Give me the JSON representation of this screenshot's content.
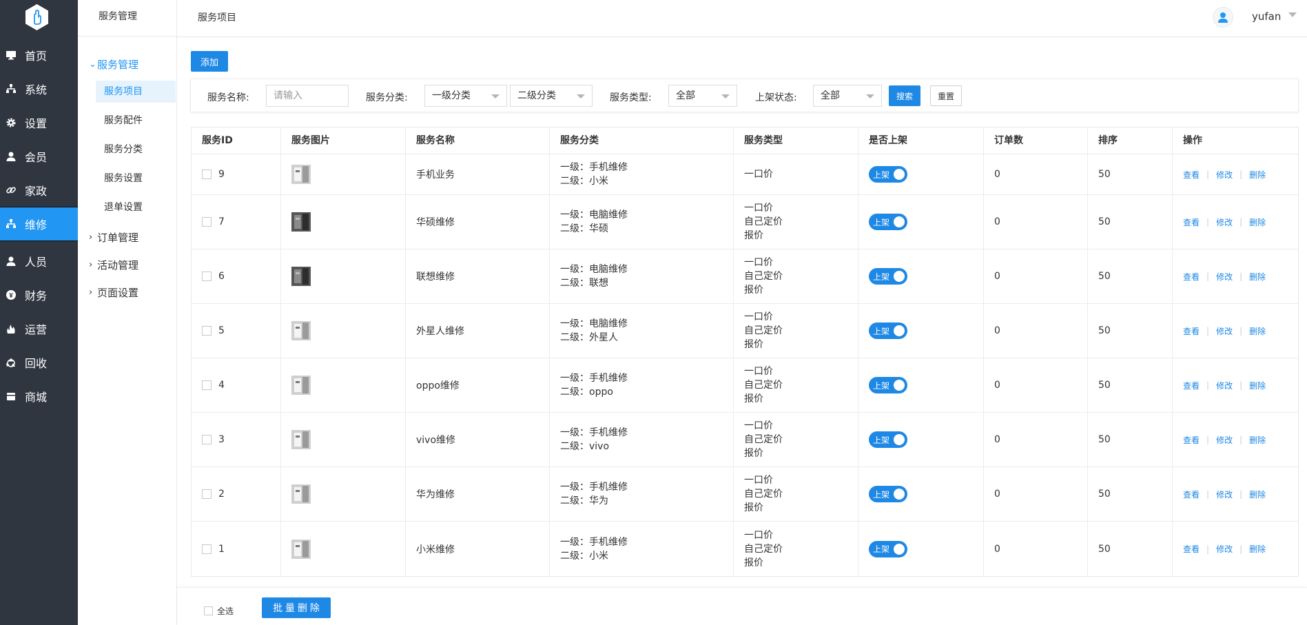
{
  "app": {
    "logo_icon": "hand-logo-icon"
  },
  "nav": {
    "items": [
      {
        "label": "首页",
        "icon": "monitor-icon"
      },
      {
        "label": "系统",
        "icon": "sitemap-icon"
      },
      {
        "label": "设置",
        "icon": "gear-icon"
      },
      {
        "label": "会员",
        "icon": "user-icon"
      },
      {
        "label": "家政",
        "icon": "link-icon"
      },
      {
        "label": "维修",
        "icon": "sitemap-icon",
        "active": true
      },
      {
        "label": "人员",
        "icon": "user-icon"
      },
      {
        "label": "财务",
        "icon": "yen-icon"
      },
      {
        "label": "运营",
        "icon": "fire-icon"
      },
      {
        "label": "回收",
        "icon": "recycle-icon"
      },
      {
        "label": "商城",
        "icon": "shop-icon"
      }
    ]
  },
  "submenu": {
    "header": "服务管理",
    "groups": [
      {
        "label": "服务管理",
        "expanded": true
      },
      {
        "label": "订单管理"
      },
      {
        "label": "活动管理"
      },
      {
        "label": "页面设置"
      }
    ],
    "items": [
      "服务项目",
      "服务配件",
      "服务分类",
      "服务设置",
      "退单设置"
    ]
  },
  "header": {
    "breadcrumb": "服务项目",
    "username": "yufan"
  },
  "toolbar": {
    "add_label": "添加"
  },
  "filter": {
    "name_label": "服务名称:",
    "name_placeholder": "请输入",
    "category_label": "服务分类:",
    "category1": "一级分类",
    "category2": "二级分类",
    "type_label": "服务类型:",
    "type_value": "全部",
    "status_label": "上架状态:",
    "status_value": "全部",
    "search_label": "搜索",
    "reset_label": "重置"
  },
  "table": {
    "columns": [
      "服务ID",
      "服务图片",
      "服务名称",
      "服务分类",
      "服务类型",
      "是否上架",
      "订单数",
      "排序",
      "操作"
    ],
    "rows": [
      {
        "id": "9",
        "thumb": "light",
        "name": "手机业务",
        "cat1": "一级：手机维修",
        "cat2": "二级：小米",
        "types": [
          "一口价"
        ],
        "switch": "上架",
        "orders": "0",
        "sort": "50"
      },
      {
        "id": "7",
        "thumb": "dark",
        "name": "华硕维修",
        "cat1": "一级：电脑维修",
        "cat2": "二级：华硕",
        "types": [
          "一口价",
          "自己定价",
          "报价"
        ],
        "switch": "上架",
        "orders": "0",
        "sort": "50"
      },
      {
        "id": "6",
        "thumb": "dark",
        "name": "联想维修",
        "cat1": "一级：电脑维修",
        "cat2": "二级：联想",
        "types": [
          "一口价",
          "自己定价",
          "报价"
        ],
        "switch": "上架",
        "orders": "0",
        "sort": "50"
      },
      {
        "id": "5",
        "thumb": "light",
        "name": "外星人维修",
        "cat1": "一级：电脑维修",
        "cat2": "二级：外星人",
        "types": [
          "一口价",
          "自己定价",
          "报价"
        ],
        "switch": "上架",
        "orders": "0",
        "sort": "50"
      },
      {
        "id": "4",
        "thumb": "light",
        "name": "oppo维修",
        "cat1": "一级：手机维修",
        "cat2": "二级：oppo",
        "types": [
          "一口价",
          "自己定价",
          "报价"
        ],
        "switch": "上架",
        "orders": "0",
        "sort": "50"
      },
      {
        "id": "3",
        "thumb": "light",
        "name": "vivo维修",
        "cat1": "一级：手机维修",
        "cat2": "二级：vivo",
        "types": [
          "一口价",
          "自己定价",
          "报价"
        ],
        "switch": "上架",
        "orders": "0",
        "sort": "50"
      },
      {
        "id": "2",
        "thumb": "light",
        "name": "华为维修",
        "cat1": "一级：手机维修",
        "cat2": "二级：华为",
        "types": [
          "一口价",
          "自己定价",
          "报价"
        ],
        "switch": "上架",
        "orders": "0",
        "sort": "50"
      },
      {
        "id": "1",
        "thumb": "light",
        "name": "小米维修",
        "cat1": "一级：手机维修",
        "cat2": "二级：小米",
        "types": [
          "一口价",
          "自己定价",
          "报价"
        ],
        "switch": "上架",
        "orders": "0",
        "sort": "50"
      }
    ],
    "actions": [
      "查看",
      "修改",
      "删除"
    ]
  },
  "footer": {
    "select_all": "全选",
    "batch_delete": "批 量 删 除"
  },
  "colors": {
    "primary": "#1e88e5",
    "nav_bg": "#2f3640",
    "nav_active": "#2196f3"
  }
}
